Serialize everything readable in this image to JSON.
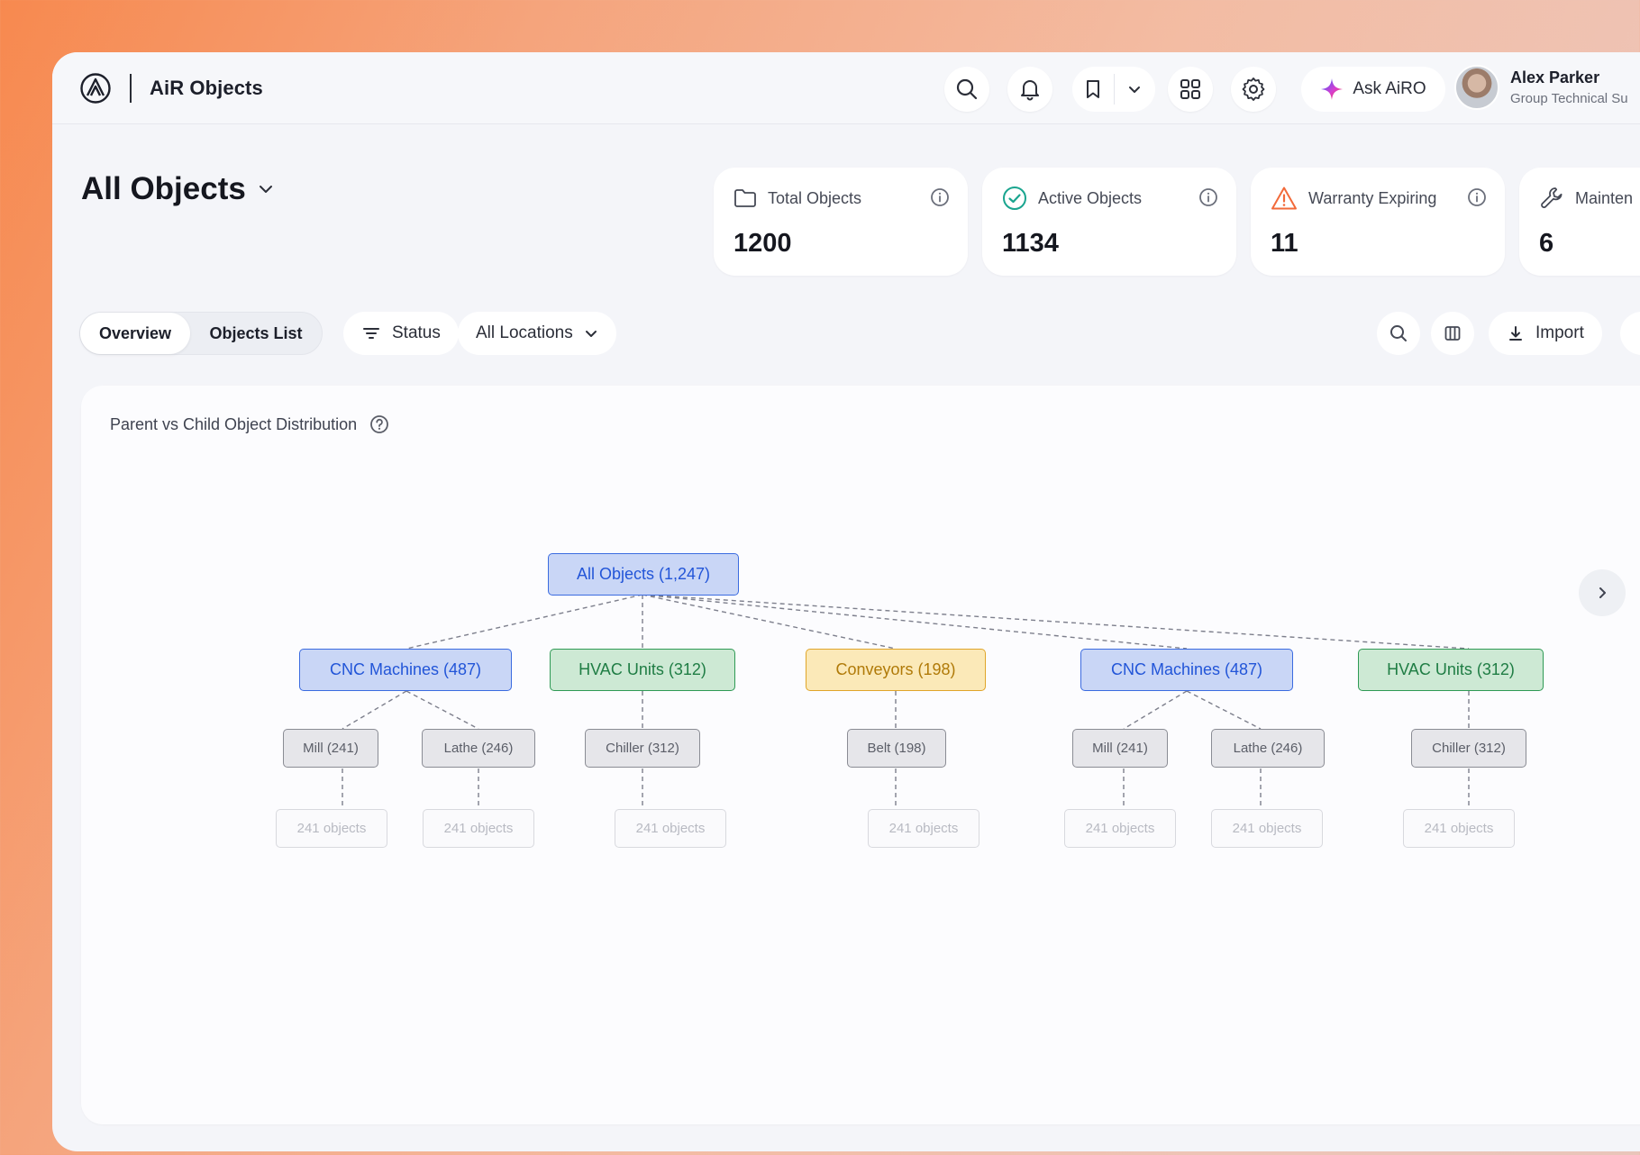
{
  "app": {
    "title": "AiR Objects"
  },
  "header": {
    "ask_label": "Ask AiRO",
    "user": {
      "name": "Alex Parker",
      "role": "Group Technical Su"
    }
  },
  "page": {
    "title": "All Objects"
  },
  "stats": [
    {
      "label": "Total Objects",
      "value": "1200",
      "icon": "folder-icon"
    },
    {
      "label": "Active Objects",
      "value": "1134",
      "icon": "check-circle-icon"
    },
    {
      "label": "Warranty Expiring",
      "value": "11",
      "icon": "warning-icon"
    },
    {
      "label": "Mainten",
      "value": "6",
      "icon": "wrench-icon"
    }
  ],
  "toolbar": {
    "tabs": [
      "Overview",
      "Objects List"
    ],
    "status_label": "Status",
    "locations_label": "All Locations",
    "import_label": "Import"
  },
  "chart": {
    "title": "Parent vs Child Object Distribution",
    "root": "All Objects (1,247)",
    "parents": [
      "CNC Machines (487)",
      "HVAC Units (312)",
      "Conveyors (198)",
      "CNC Machines (487)",
      "HVAC Units (312)"
    ],
    "children": [
      "Mill (241)",
      "Lathe (246)",
      "Chiller (312)",
      "Belt (198)",
      "Mill (241)",
      "Lathe (246)",
      "Chiller (312)"
    ],
    "leaves": [
      "241 objects",
      "241 objects",
      "241 objects",
      "241 objects",
      "241 objects",
      "241 objects",
      "241 objects"
    ]
  },
  "colors": {
    "accent_blue": "#3b6be0",
    "green": "#2f9a55",
    "yellow": "#e0a52a",
    "warning": "#f26a3a",
    "success": "#1aa58f"
  }
}
